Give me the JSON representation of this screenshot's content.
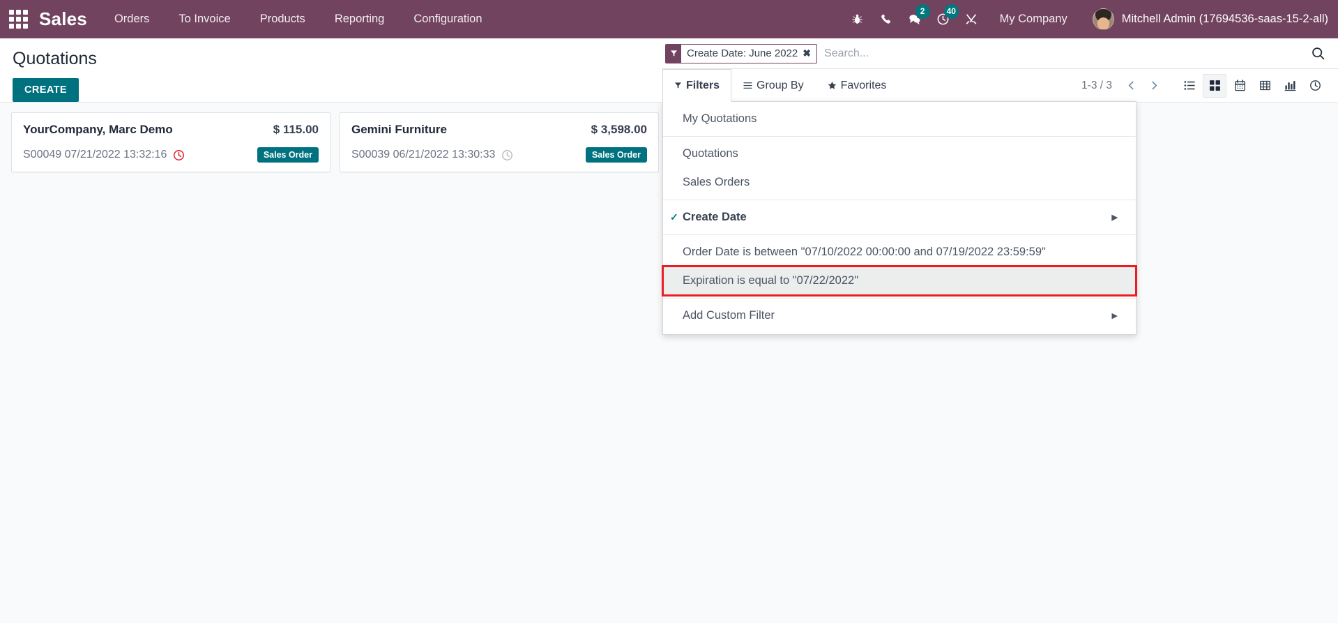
{
  "navbar": {
    "apps_icon": "apps-grid-icon",
    "brand": "Sales",
    "menu_items": [
      {
        "label": "Orders"
      },
      {
        "label": "To Invoice"
      },
      {
        "label": "Products"
      },
      {
        "label": "Reporting"
      },
      {
        "label": "Configuration"
      }
    ],
    "icons": [
      {
        "name": "bug-icon",
        "badge": ""
      },
      {
        "name": "phone-icon",
        "badge": ""
      },
      {
        "name": "messages-icon",
        "badge": "2"
      },
      {
        "name": "activities-clock-icon",
        "badge": "40"
      },
      {
        "name": "tools-wrench-icon",
        "badge": ""
      }
    ],
    "company": "My Company",
    "user": "Mitchell Admin (17694536-saas-15-2-all)",
    "bg_color": "#71435f",
    "badge_color": "#00787e"
  },
  "control_panel": {
    "title": "Quotations",
    "create_label": "CREATE",
    "create_color": "#00727f"
  },
  "search": {
    "facet": {
      "icon": "filter-funnel-icon",
      "label": "Create Date: June 2022",
      "remove": "✖"
    },
    "placeholder": "Search...",
    "value": ""
  },
  "toolbar": {
    "filters_label": "Filters",
    "group_by_label": "Group By",
    "favorites_label": "Favorites",
    "pager": "1-3 / 3",
    "views": [
      {
        "name": "list-view",
        "label": "List",
        "active": false
      },
      {
        "name": "kanban-view",
        "label": "Kanban",
        "active": true
      },
      {
        "name": "calendar-view",
        "label": "Calendar",
        "active": false
      },
      {
        "name": "pivot-view",
        "label": "Pivot",
        "active": false
      },
      {
        "name": "graph-view",
        "label": "Graph",
        "active": false
      },
      {
        "name": "activity-view",
        "label": "Activity",
        "active": false
      }
    ]
  },
  "filters_dropdown": {
    "groups": [
      {
        "items": [
          {
            "label": "My Quotations",
            "checked": false,
            "submenu": false,
            "highlighted": false
          }
        ]
      },
      {
        "items": [
          {
            "label": "Quotations",
            "checked": false,
            "submenu": false,
            "highlighted": false
          },
          {
            "label": "Sales Orders",
            "checked": false,
            "submenu": false,
            "highlighted": false
          }
        ]
      },
      {
        "items": [
          {
            "label": "Create Date",
            "checked": true,
            "submenu": true,
            "highlighted": false
          }
        ]
      },
      {
        "items": [
          {
            "label": "Order Date is between \"07/10/2022 00:00:00 and 07/19/2022 23:59:59\"",
            "checked": false,
            "submenu": false,
            "highlighted": false
          },
          {
            "label": "Expiration is equal to \"07/22/2022\"",
            "checked": false,
            "submenu": false,
            "highlighted": true
          }
        ]
      },
      {
        "items": [
          {
            "label": "Add Custom Filter",
            "checked": false,
            "submenu": true,
            "highlighted": false
          }
        ]
      }
    ],
    "highlight_color": "#ec1c24"
  },
  "kanban": {
    "cards": [
      {
        "customer": "YourCompany, Marc Demo",
        "amount": "$ 115.00",
        "reference": "S00049 07/21/2022 13:32:16",
        "clock": {
          "name": "clock-icon",
          "color": "#e01e26"
        },
        "badge": "Sales Order"
      },
      {
        "customer": "Gemini Furniture",
        "amount": "$ 3,598.00",
        "reference": "S00039 06/21/2022 13:30:33",
        "clock": {
          "name": "clock-icon",
          "color": "#b9bcc0"
        },
        "badge": "Sales Order"
      }
    ]
  }
}
